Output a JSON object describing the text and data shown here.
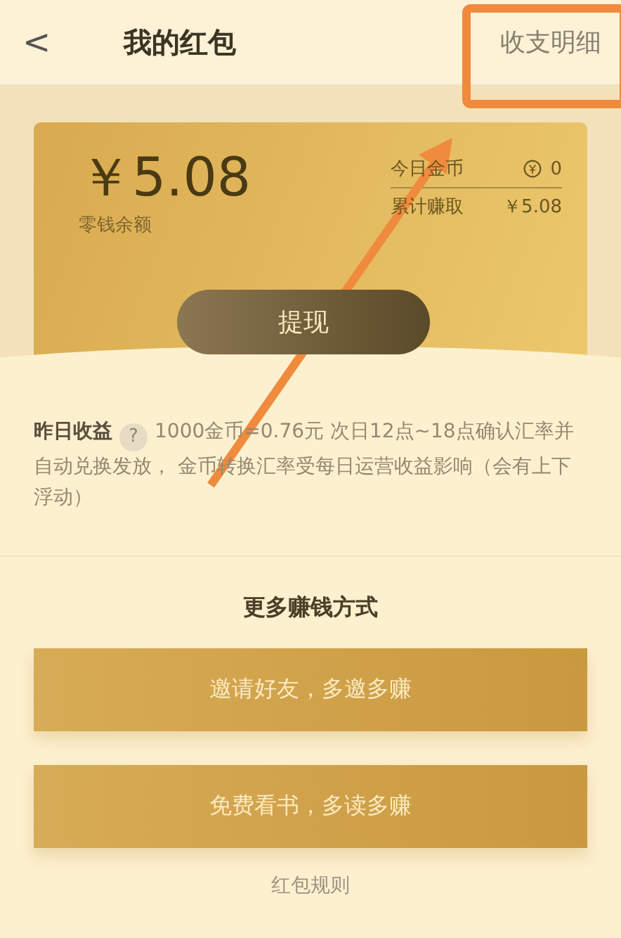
{
  "header": {
    "back": "<",
    "title": "我的红包",
    "action": "收支明细"
  },
  "card": {
    "balance": "￥5.08",
    "balance_label": "零钱余额",
    "stats": [
      {
        "label": "今日金币",
        "value": "0",
        "kind": "coin"
      },
      {
        "label": "累计赚取",
        "value": "￥5.08",
        "kind": "plain"
      }
    ],
    "withdraw": "提现"
  },
  "info": {
    "title": "昨日收益",
    "help": "?",
    "text": "1000金币=0.76元 次日12点~18点确认汇率并自动兑换发放， 金币转换汇率受每日运营收益影响（会有上下浮动）"
  },
  "more": {
    "title": "更多赚钱方式",
    "buttons": [
      "邀请好友，多邀多赚",
      "免费看书，多读多赚"
    ],
    "rules": "红包规则"
  }
}
